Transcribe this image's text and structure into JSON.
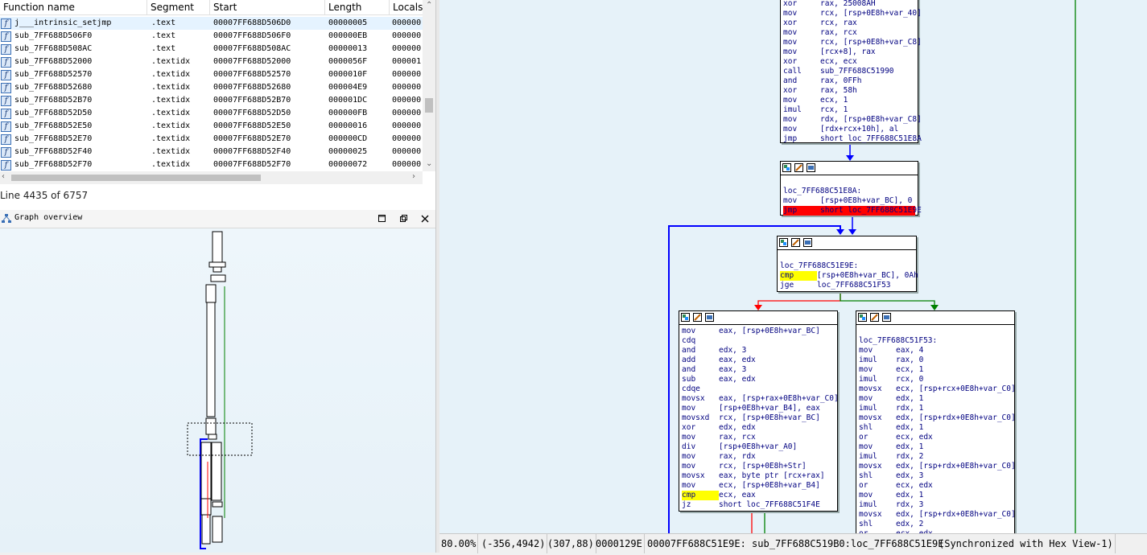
{
  "functions_table": {
    "columns": [
      "Function name",
      "Segment",
      "Start",
      "Length",
      "Locals"
    ],
    "rows": [
      {
        "name": "j___intrinsic_setjmp",
        "segment": ".text",
        "start": "00007FF688D506D0",
        "length": "00000005",
        "locals": "000000"
      },
      {
        "name": "sub_7FF688D506F0",
        "segment": ".text",
        "start": "00007FF688D506F0",
        "length": "000000EB",
        "locals": "000000"
      },
      {
        "name": "sub_7FF688D508AC",
        "segment": ".text",
        "start": "00007FF688D508AC",
        "length": "00000013",
        "locals": "000000"
      },
      {
        "name": "sub_7FF688D52000",
        "segment": ".textidx",
        "start": "00007FF688D52000",
        "length": "0000056F",
        "locals": "000001"
      },
      {
        "name": "sub_7FF688D52570",
        "segment": ".textidx",
        "start": "00007FF688D52570",
        "length": "0000010F",
        "locals": "000000"
      },
      {
        "name": "sub_7FF688D52680",
        "segment": ".textidx",
        "start": "00007FF688D52680",
        "length": "000004E9",
        "locals": "000000"
      },
      {
        "name": "sub_7FF688D52B70",
        "segment": ".textidx",
        "start": "00007FF688D52B70",
        "length": "000001DC",
        "locals": "000000"
      },
      {
        "name": "sub_7FF688D52D50",
        "segment": ".textidx",
        "start": "00007FF688D52D50",
        "length": "000000FB",
        "locals": "000000"
      },
      {
        "name": "sub_7FF688D52E50",
        "segment": ".textidx",
        "start": "00007FF688D52E50",
        "length": "00000016",
        "locals": "000000"
      },
      {
        "name": "sub_7FF688D52E70",
        "segment": ".textidx",
        "start": "00007FF688D52E70",
        "length": "000000CD",
        "locals": "000000"
      },
      {
        "name": "sub_7FF688D52F40",
        "segment": ".textidx",
        "start": "00007FF688D52F40",
        "length": "00000025",
        "locals": "000000"
      },
      {
        "name": "sub_7FF688D52F70",
        "segment": ".textidx",
        "start": "00007FF688D52F70",
        "length": "00000072",
        "locals": "000000"
      }
    ],
    "row_icon_glyph": "f"
  },
  "line_status": "Line 4435 of 6757",
  "graph_overview": {
    "title": "Graph overview"
  },
  "blocks": {
    "top": [
      [
        "xor",
        "rax, 25008AH"
      ],
      [
        "mov",
        "rcx, [rsp+0E8h+var_40]"
      ],
      [
        "xor",
        "rcx, rax"
      ],
      [
        "mov",
        "rax, rcx"
      ],
      [
        "mov",
        "rcx, [rsp+0E8h+var_C8]"
      ],
      [
        "mov",
        "[rcx+8], rax"
      ],
      [
        "xor",
        "ecx, ecx"
      ],
      [
        "call",
        "sub_7FF688C51990"
      ],
      [
        "and",
        "rax, 0FFh"
      ],
      [
        "xor",
        "rax, 58h"
      ],
      [
        "mov",
        "ecx, 1"
      ],
      [
        "imul",
        "rcx, 1"
      ],
      [
        "mov",
        "rdx, [rsp+0E8h+var_C8]"
      ],
      [
        "mov",
        "[rdx+rcx+10h], al"
      ],
      [
        "jmp",
        "short loc_7FF688C51E8A"
      ]
    ],
    "e8a": {
      "label": "loc_7FF688C51E8A:",
      "lines": [
        [
          "mov",
          "[rsp+0E8h+var_BC], 0"
        ],
        [
          "jmp",
          "short loc_7FF688C51E9E"
        ]
      ]
    },
    "e9e": {
      "label": "loc_7FF688C51E9E:",
      "lines": [
        [
          "cmp",
          "[rsp+0E8h+var_BC], 0Ah"
        ],
        [
          "jge",
          "loc_7FF688C51F53"
        ]
      ]
    },
    "left": [
      [
        "mov",
        "eax, [rsp+0E8h+var_BC]"
      ],
      [
        "cdq",
        ""
      ],
      [
        "and",
        "edx, 3"
      ],
      [
        "add",
        "eax, edx"
      ],
      [
        "and",
        "eax, 3"
      ],
      [
        "sub",
        "eax, edx"
      ],
      [
        "cdqe",
        ""
      ],
      [
        "movsx",
        "eax, [rsp+rax+0E8h+var_C0]"
      ],
      [
        "mov",
        "[rsp+0E8h+var_B4], eax"
      ],
      [
        "movsxd",
        "rcx, [rsp+0E8h+var_BC]"
      ],
      [
        "xor",
        "edx, edx"
      ],
      [
        "mov",
        "rax, rcx"
      ],
      [
        "div",
        "[rsp+0E8h+var_A0]"
      ],
      [
        "mov",
        "rax, rdx"
      ],
      [
        "mov",
        "rcx, [rsp+0E8h+Str]"
      ],
      [
        "movsx",
        "eax, byte ptr [rcx+rax]"
      ],
      [
        "mov",
        "ecx, [rsp+0E8h+var_B4]"
      ],
      [
        "cmp",
        "ecx, eax"
      ],
      [
        "jz",
        "short loc_7FF688C51F4E"
      ]
    ],
    "f53": {
      "label": "loc_7FF688C51F53:",
      "lines": [
        [
          "mov",
          "eax, 4"
        ],
        [
          "imul",
          "rax, 0"
        ],
        [
          "mov",
          "ecx, 1"
        ],
        [
          "imul",
          "rcx, 0"
        ],
        [
          "movsx",
          "ecx, [rsp+rcx+0E8h+var_C0]"
        ],
        [
          "mov",
          "edx, 1"
        ],
        [
          "imul",
          "rdx, 1"
        ],
        [
          "movsx",
          "edx, [rsp+rdx+0E8h+var_C0]"
        ],
        [
          "shl",
          "edx, 1"
        ],
        [
          "or",
          "ecx, edx"
        ],
        [
          "mov",
          "edx, 1"
        ],
        [
          "imul",
          "rdx, 2"
        ],
        [
          "movsx",
          "edx, [rsp+rdx+0E8h+var_C0]"
        ],
        [
          "shl",
          "edx, 3"
        ],
        [
          "or",
          "ecx, edx"
        ],
        [
          "mov",
          "edx, 1"
        ],
        [
          "imul",
          "rdx, 3"
        ],
        [
          "movsx",
          "edx, [rsp+rdx+0E8h+var_C0]"
        ],
        [
          "shl",
          "edx, 2"
        ],
        [
          "or",
          "ecx, edx"
        ]
      ]
    }
  },
  "graph_status": {
    "zoom": "80.00%",
    "cursor": "(-356,4942)",
    "pos": "(307,88)",
    "offset": "0000129E",
    "address": "00007FF688C51E9E: sub_7FF688C519B0:loc_7FF688C51E9E",
    "sync": "(Synchronized with Hex View-1)"
  },
  "colors": {
    "selected_row": "#e5f3ff",
    "graph_bg": "#e6f2f9",
    "highlight_yellow": "#ffff00",
    "highlight_red": "#ff0000",
    "edge_blue": "#0000ff",
    "edge_red": "#ff0000",
    "edge_green": "#008000"
  }
}
